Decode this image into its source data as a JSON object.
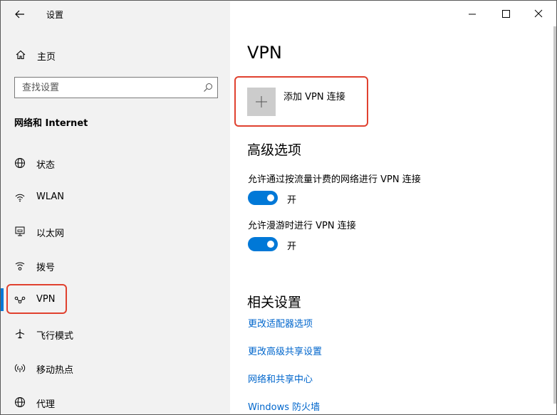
{
  "window": {
    "title": "设置"
  },
  "sidebar": {
    "home_label": "主页",
    "search_placeholder": "查找设置",
    "section_title": "网络和 Internet",
    "items": [
      {
        "label": "状态",
        "icon": "globe-status-icon"
      },
      {
        "label": "WLAN",
        "icon": "wifi-icon"
      },
      {
        "label": "以太网",
        "icon": "ethernet-icon"
      },
      {
        "label": "拨号",
        "icon": "dialup-icon"
      },
      {
        "label": "VPN",
        "icon": "vpn-icon",
        "active": true
      },
      {
        "label": "飞行模式",
        "icon": "airplane-icon"
      },
      {
        "label": "移动热点",
        "icon": "hotspot-icon"
      },
      {
        "label": "代理",
        "icon": "globe-icon"
      }
    ]
  },
  "main": {
    "title": "VPN",
    "add_vpn_label": "添加 VPN 连接",
    "advanced": {
      "title": "高级选项",
      "options": [
        {
          "label": "允许通过按流量计费的网络进行 VPN 连接",
          "state": "开",
          "on": true
        },
        {
          "label": "允许漫游时进行 VPN 连接",
          "state": "开",
          "on": true
        }
      ]
    },
    "related": {
      "title": "相关设置",
      "links": [
        "更改适配器选项",
        "更改高级共享设置",
        "网络和共享中心",
        "Windows 防火墙"
      ]
    }
  },
  "colors": {
    "accent": "#0078d7",
    "link": "#0066cc",
    "highlight": "#e0412f",
    "sidebar_bg": "#f2f2f2"
  }
}
